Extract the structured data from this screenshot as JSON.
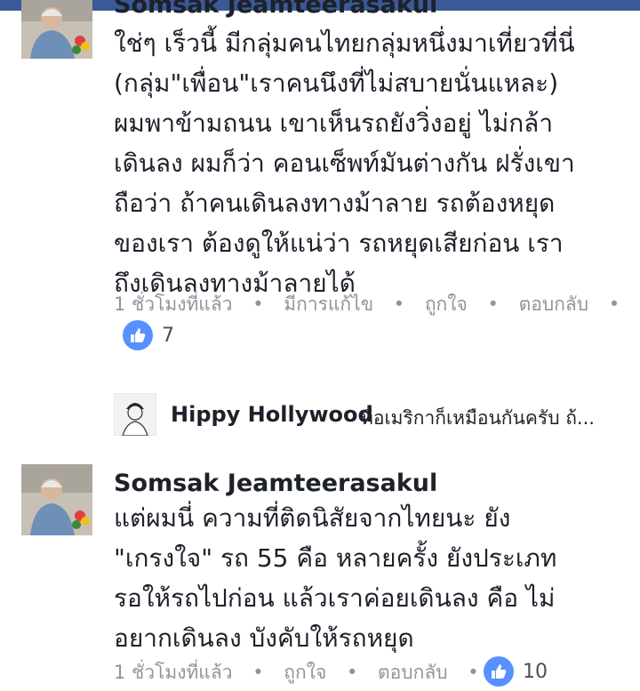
{
  "comments": [
    {
      "author": "Somsak Jeamteerasakul",
      "lines": [
        "ใช่ๆ เร็วนี้ มีกลุ่มคนไทยกลุ่มหนึ่งมาเที่ยวที่นี่",
        "(กลุ่ม\"เพื่อน\"เราคนนึงที่ไม่สบายนั่นแหละ)",
        "ผมพาข้ามถนน เขาเห็นรถยังวิ่งอยู่ ไม่กล้า",
        "เดินลง ผมก็ว่า คอนเซ็พท์มันต่างกัน ฝรั่งเขา",
        "ถือว่า ถ้าคนเดินลงทางม้าลาย รถต้องหยุด",
        "ของเรา ต้องดูให้แน่ว่า รถหยุดเสียก่อน เรา",
        "ถึงเดินลงทางม้าลายได้"
      ],
      "time": "1 ชั่วโมงที่แล้ว",
      "edited": "มีการแก้ไข",
      "like_label": "ถูกใจ",
      "reply_label": "ตอบกลับ",
      "like_count": "7",
      "separator": "•"
    },
    {
      "author": "Somsak Jeamteerasakul",
      "lines": [
        "แต่ผมนี่ ความที่ติดนิสัยจากไทยนะ ยัง",
        "\"เกรงใจ\" รถ 55 คือ หลายครั้ง ยังประเภท",
        "รอให้รถไปก่อน แล้วเราค่อยเดินลง คือ ไม่",
        "อยากเดินลง บังคับให้รถหยุด"
      ],
      "time": "1 ชั่วโมงที่แล้ว",
      "like_label": "ถูกใจ",
      "reply_label": "ตอบกลับ",
      "like_count": "10",
      "separator": "•"
    }
  ],
  "reply_preview": {
    "author": "Hippy Hollywood",
    "text": "ที่อเมริกาก็เหมือนกันครับ ถ้..."
  },
  "colors": {
    "brand": "#3b5998",
    "like_blue": "#5890ff",
    "meta_gray": "#90949c",
    "text": "#1d2129"
  }
}
